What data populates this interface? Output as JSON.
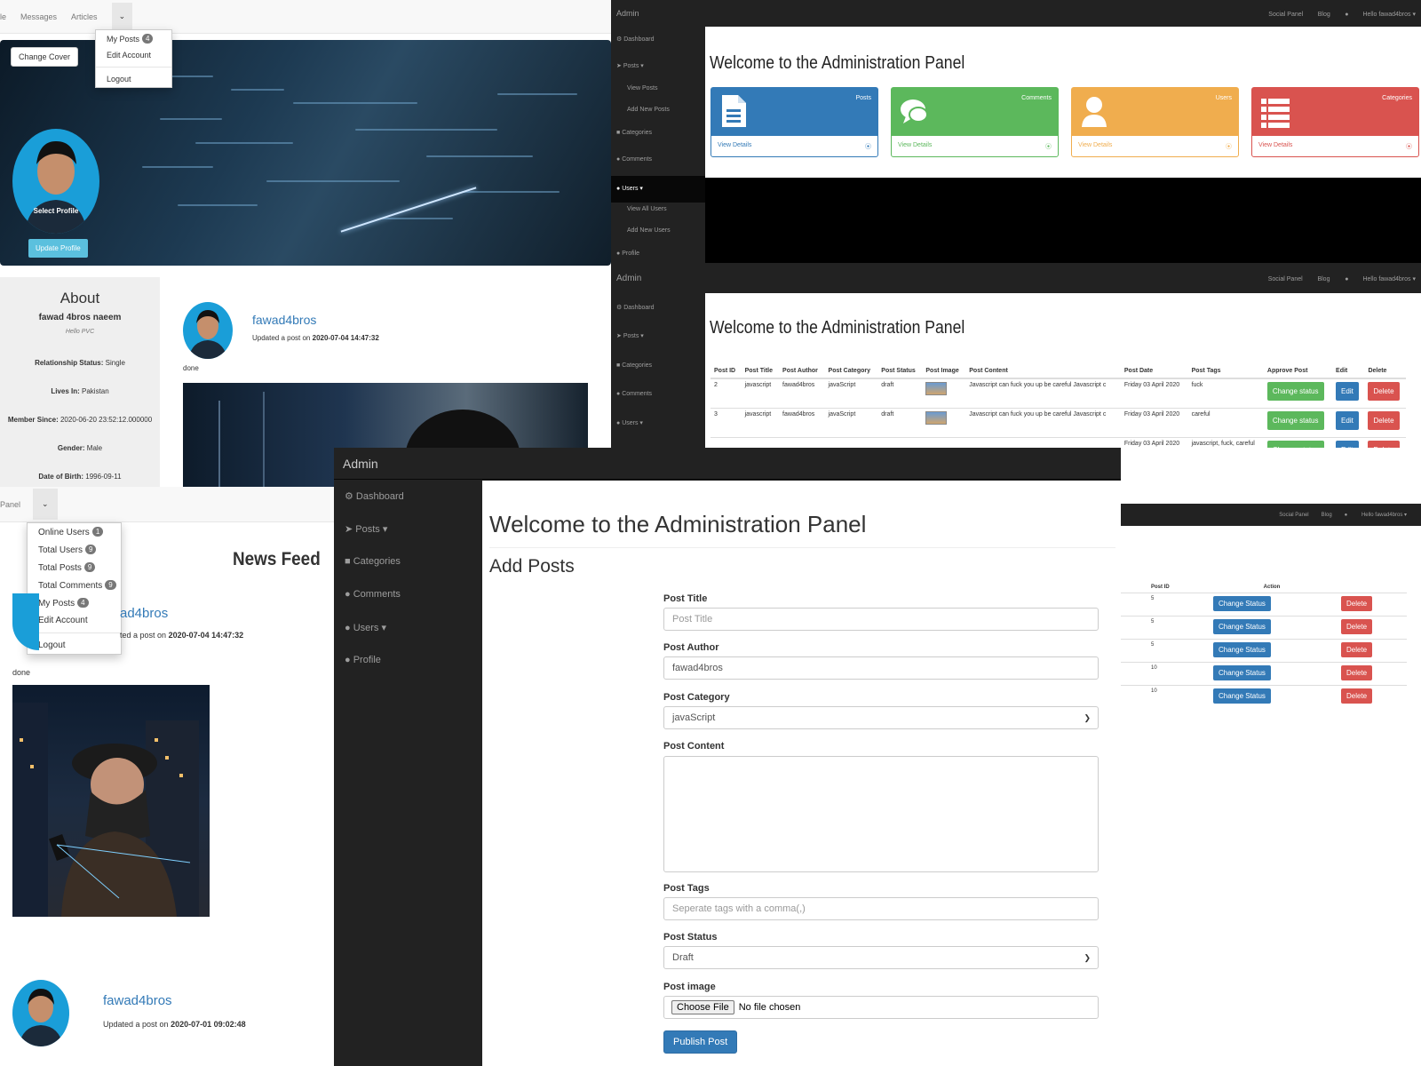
{
  "profile": {
    "nav": [
      "le",
      "Messages",
      "Articles"
    ],
    "menu": [
      {
        "label": "My Posts",
        "badge": "4"
      },
      {
        "label": "Edit Account"
      },
      {
        "label": "Logout"
      }
    ],
    "change_cover": "Change Cover",
    "select_profile": "Select Profile",
    "update_profile": "Update Profile",
    "about": {
      "title": "About",
      "name": "fawad 4bros naeem",
      "bio": "Hello PVC",
      "rows": [
        {
          "k": "Relationship Status:",
          "v": "Single"
        },
        {
          "k": "Lives In:",
          "v": "Pakistan"
        },
        {
          "k": "Member Since:",
          "v": "2020-06-20 23:52:12.000000"
        },
        {
          "k": "Gender:",
          "v": "Male"
        },
        {
          "k": "Date of Birth:",
          "v": "1996-09-11"
        }
      ]
    },
    "post": {
      "user": "fawad4bros",
      "text": "Updated a post on",
      "date": "2020-07-04 14:47:32",
      "body": "done"
    }
  },
  "admin_top": {
    "brand": "Admin",
    "nav_right": [
      "Social Panel",
      "Blog",
      "Hello fawad4bros"
    ],
    "sidebar": [
      "Dashboard",
      "Posts",
      "View Posts",
      "Add New Posts",
      "Categories",
      "Comments",
      "Users",
      "View All Users",
      "Add New Users",
      "Profile"
    ],
    "heading": "Welcome to the Administration Panel",
    "cards": [
      {
        "title": "Posts",
        "footer": "View Details",
        "color": "#337ab7"
      },
      {
        "title": "Comments",
        "footer": "View Details",
        "color": "#5cb85c"
      },
      {
        "title": "Users",
        "footer": "View Details",
        "color": "#f0ad4e"
      },
      {
        "title": "Categories",
        "footer": "View Details",
        "color": "#d9534f"
      }
    ]
  },
  "admin_mid": {
    "brand": "Admin",
    "nav_right": [
      "Social Panel",
      "Blog",
      "Hello fawad4bros"
    ],
    "sidebar": [
      "Dashboard",
      "Posts",
      "Categories",
      "Comments",
      "Users"
    ],
    "heading": "Welcome to the Administration Panel",
    "columns": [
      "Post ID",
      "Post Title",
      "Post Author",
      "Post Category",
      "Post Status",
      "Post Image",
      "Post Content",
      "Post Date",
      "Post Tags",
      "Approve Post",
      "Edit",
      "Delete"
    ],
    "rows": [
      {
        "id": "2",
        "title": "javascript",
        "author": "fawad4bros",
        "category": "javaScript",
        "status": "draft",
        "content": "Javascript can fuck you up be careful Javascript c",
        "date": "Friday 03 April 2020",
        "tags": "fuck"
      },
      {
        "id": "3",
        "title": "javascript",
        "author": "fawad4bros",
        "category": "javaScript",
        "status": "draft",
        "content": "Javascript can fuck you up be careful Javascript c",
        "date": "Friday 03 April 2020",
        "tags": "careful"
      },
      {
        "id": "",
        "title": "",
        "author": "",
        "category": "",
        "status": "",
        "content": "",
        "date": "Friday 03 April 2020",
        "tags": "javascript, fuck, careful"
      }
    ],
    "approve_label": "Change status",
    "edit_label": "Edit",
    "delete_label": "Delete"
  },
  "admin_small": {
    "nav_right": [
      "Social Panel",
      "Blog",
      "Hello fawad4bros"
    ],
    "columns": [
      "Post ID",
      "Action"
    ],
    "rows": [
      "5",
      "5",
      "5",
      "10",
      "10"
    ],
    "status_label": "Change Status",
    "delete_label": "Delete"
  },
  "feed": {
    "nav_left": "Panel",
    "menu": [
      {
        "label": "Online Users",
        "badge": "1"
      },
      {
        "label": "Total Users",
        "badge": "9"
      },
      {
        "label": "Total Posts",
        "badge": "9"
      },
      {
        "label": "Total Comments",
        "badge": "9"
      },
      {
        "label": "My Posts",
        "badge": "4"
      },
      {
        "label": "Edit Account"
      },
      {
        "label": "Logout"
      }
    ],
    "title": "News Feed",
    "post1": {
      "user": "ad4bros",
      "text": "ted a post on",
      "date": "2020-07-04 14:47:32",
      "body": "done"
    },
    "post2": {
      "user": "fawad4bros",
      "text": "Updated a post on",
      "date": "2020-07-01 09:02:48"
    }
  },
  "add_post": {
    "brand": "Admin",
    "sidebar": [
      "Dashboard",
      "Posts",
      "Categories",
      "Comments",
      "Users",
      "Profile"
    ],
    "heading": "Welcome to the Administration Panel",
    "subheading": "Add Posts",
    "labels": {
      "title": "Post Title",
      "author": "Post Author",
      "category": "Post Category",
      "content": "Post Content",
      "tags": "Post Tags",
      "status": "Post Status",
      "image": "Post image"
    },
    "title_placeholder": "Post Title",
    "author_value": "fawad4bros",
    "category_value": "javaScript",
    "tags_placeholder": "Seperate tags with a comma(,)",
    "status_value": "Draft",
    "file_button": "Choose File",
    "file_text": "No file chosen",
    "submit": "Publish Post"
  }
}
